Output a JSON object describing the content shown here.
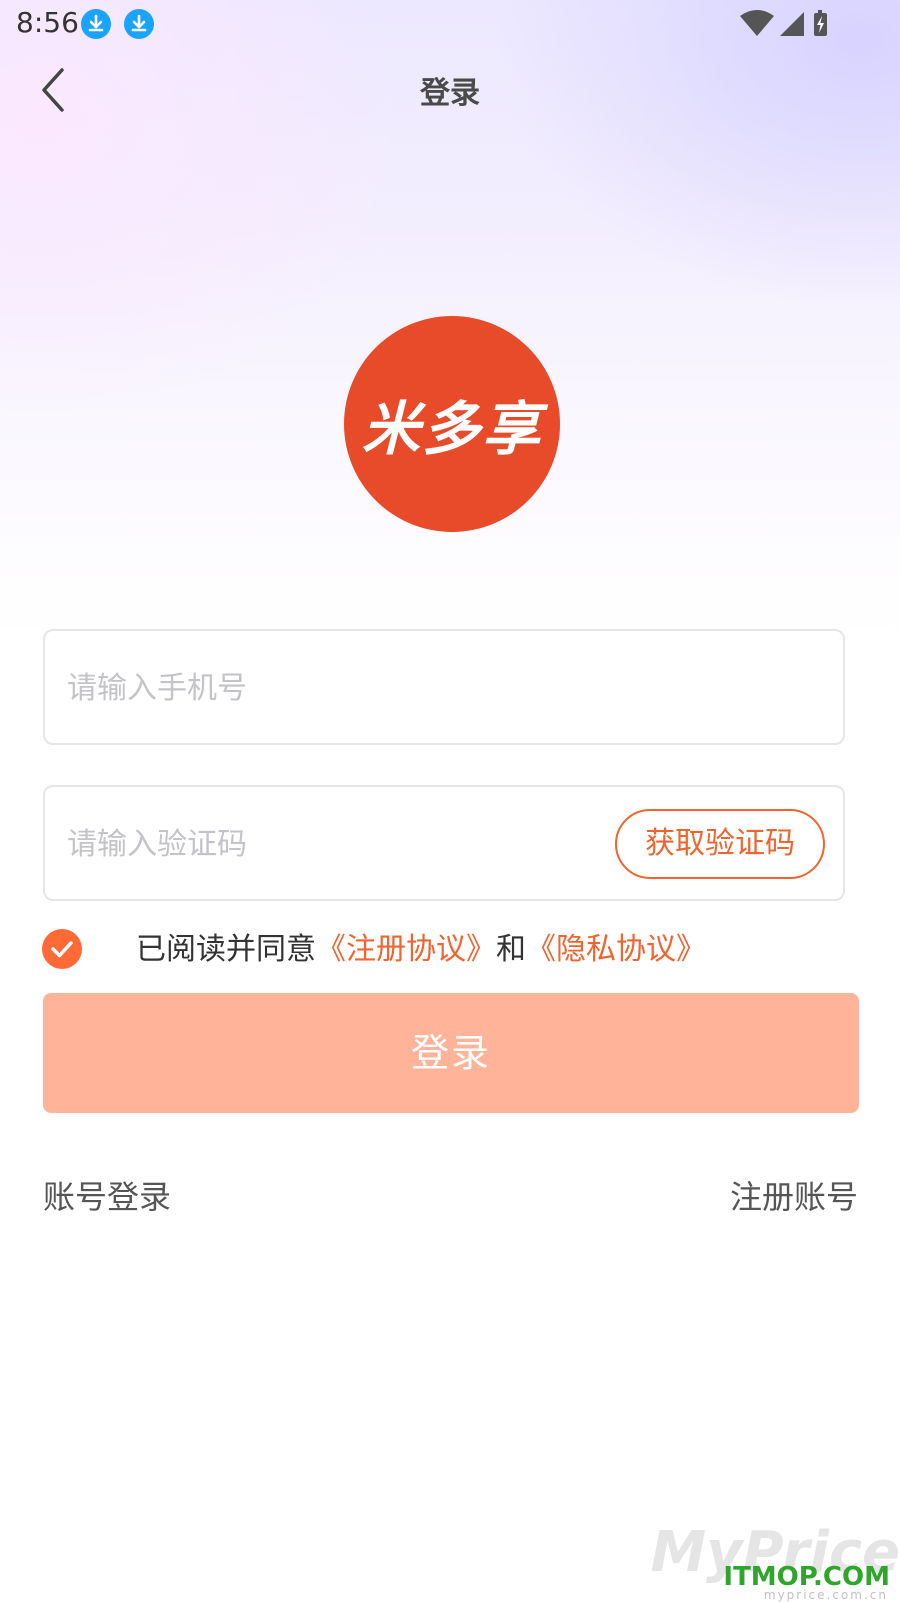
{
  "status_bar": {
    "time": "8:56",
    "notification_icons": [
      "download-icon",
      "download-icon"
    ],
    "right_icons": [
      "wifi-icon",
      "signal-icon",
      "battery-charging-icon"
    ]
  },
  "header": {
    "back_icon": "chevron-left-icon",
    "title": "登录"
  },
  "logo": {
    "text": "米多享",
    "color": "#e84b2a"
  },
  "phone_input": {
    "value": "",
    "placeholder": "请输入手机号"
  },
  "code_input": {
    "value": "",
    "placeholder": "请输入验证码"
  },
  "get_code_button": {
    "label": "获取验证码"
  },
  "agreement": {
    "checked": true,
    "prefix": "已阅读并同意",
    "register_link": "《注册协议》",
    "conjunction": "和",
    "privacy_link": "《隐私协议》"
  },
  "login_button": {
    "label": "登录",
    "color": "#ffb49a"
  },
  "bottom_links": {
    "account_login": "账号登录",
    "register": "注册账号"
  },
  "watermark": {
    "back_text": "MyPrice",
    "front_text": "ITMOP.COM",
    "sub_text": "myprice.com.cn"
  },
  "colors": {
    "accent": "#f0642f",
    "check": "#ff6a36",
    "download_badge": "#1aa3ff"
  }
}
